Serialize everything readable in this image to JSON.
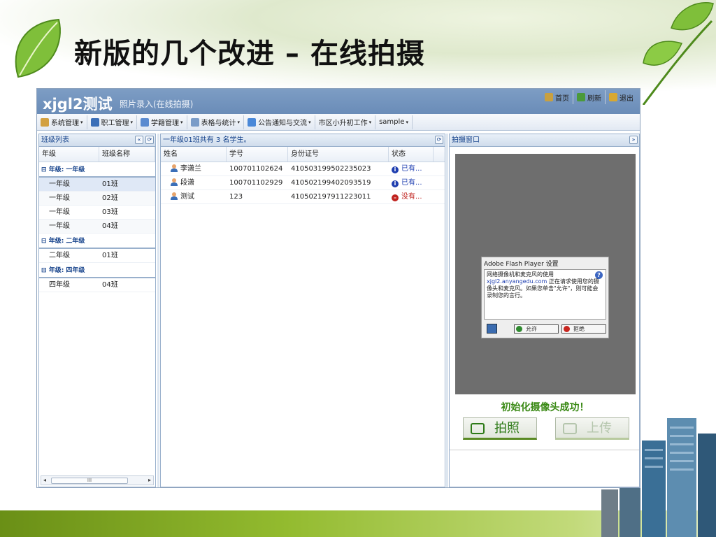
{
  "slide": {
    "title": "新版的几个改进 – 在线拍摄"
  },
  "app": {
    "name": "xjgl2测试",
    "subtitle": "照片录入(在线拍摄)"
  },
  "menu": {
    "items": [
      {
        "label": "系统管理",
        "icon": "key-icon",
        "color": "#d2a040"
      },
      {
        "label": "职工管理",
        "icon": "person-icon",
        "color": "#3b6fb8"
      },
      {
        "label": "学籍管理",
        "icon": "edit-icon",
        "color": "#5b8bd0"
      },
      {
        "label": "表格与统计",
        "icon": "table-icon",
        "color": "#7a9cc8"
      },
      {
        "label": "公告通知与交流",
        "icon": "document-icon",
        "color": "#4a88d8"
      },
      {
        "label": "市区小升初工作",
        "icon": "",
        "color": ""
      },
      {
        "label": "sample",
        "icon": "",
        "color": ""
      }
    ],
    "right": [
      {
        "label": "首页",
        "icon": "home-icon",
        "color": "#c8a040"
      },
      {
        "label": "刷新",
        "icon": "refresh-icon",
        "color": "#4a9a3a"
      },
      {
        "label": "退出",
        "icon": "exit-icon",
        "color": "#d8a830"
      }
    ]
  },
  "left_panel": {
    "title": "班级列表",
    "columns": [
      "年级",
      "班级名称"
    ],
    "groups": [
      {
        "label": "年级: 一年级",
        "rows": [
          [
            "一年级",
            "01班"
          ],
          [
            "一年级",
            "02班"
          ],
          [
            "一年级",
            "03班"
          ],
          [
            "一年级",
            "04班"
          ]
        ]
      },
      {
        "label": "年级: 二年级",
        "rows": [
          [
            "二年级",
            "01班"
          ]
        ]
      },
      {
        "label": "年级: 四年级",
        "rows": [
          [
            "四年级",
            "04班"
          ]
        ]
      }
    ],
    "scroll_label": "III"
  },
  "mid_panel": {
    "title": "一年级01班共有 3 名学生。",
    "columns": [
      "姓名",
      "学号",
      "身份证号",
      "状态"
    ],
    "rows": [
      {
        "name": "李潇兰",
        "id": "100701102624",
        "idcard": "410503199502235023",
        "status": "已有...",
        "ok": true
      },
      {
        "name": "段潇",
        "id": "100701102929",
        "idcard": "410502199402093519",
        "status": "已有...",
        "ok": true
      },
      {
        "name": "测试",
        "id": "123",
        "idcard": "410502197911223011",
        "status": "没有...",
        "ok": false
      }
    ]
  },
  "right_panel": {
    "title": "拍摄窗口",
    "flash": {
      "title": "Adobe Flash Player 设置",
      "line1": "网络摄像机和麦克风的使用",
      "link": "xjgl2.anyangedu.com",
      "text": " 正在请求使用您的摄像头和麦克风。如果您单击\"允许\"，则可能会录制您的言行。",
      "allow": "允许",
      "deny": "拒绝"
    },
    "status": "初始化摄像头成功！",
    "photo_button": "拍照",
    "upload_button": "上传"
  },
  "colors": {
    "header": "#7392bd",
    "accent_green": "#3b8a16",
    "status_ok": "#1f3fb0",
    "status_no": "#c0231f"
  }
}
